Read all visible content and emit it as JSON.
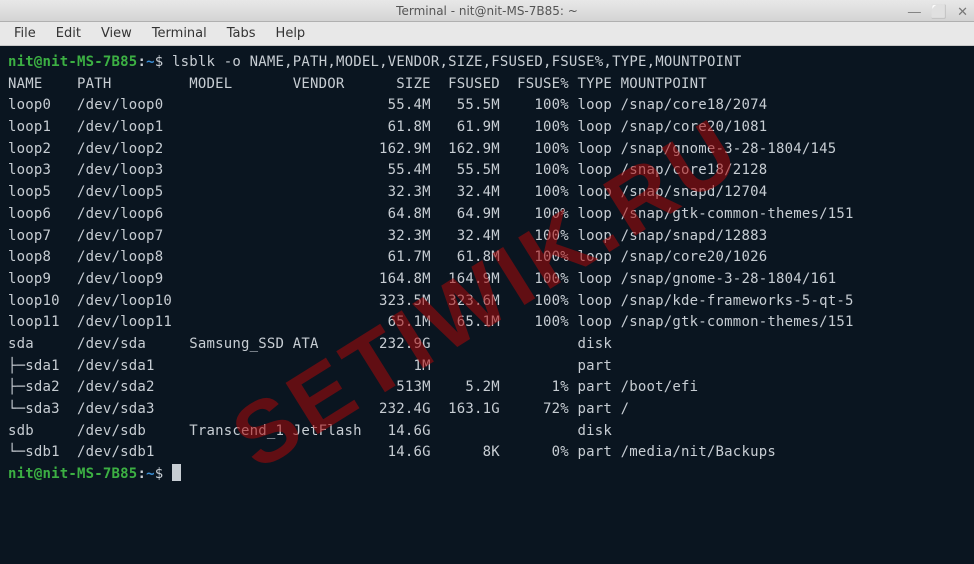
{
  "window": {
    "title": "Terminal - nit@nit-MS-7B85: ~",
    "controls": {
      "minimize": "—",
      "maximize": "⬜",
      "close": "✕"
    }
  },
  "menubar": [
    "File",
    "Edit",
    "View",
    "Terminal",
    "Tabs",
    "Help"
  ],
  "prompt": {
    "user_host": "nit@nit-MS-7B85",
    "sep": ":",
    "path": "~",
    "dollar": "$"
  },
  "command": "lsblk -o NAME,PATH,MODEL,VENDOR,SIZE,FSUSED,FSUSE%,TYPE,MOUNTPOINT",
  "header": [
    "NAME",
    "PATH",
    "MODEL",
    "VENDOR",
    "SIZE",
    "FSUSED",
    "FSUSE%",
    "TYPE",
    "MOUNTPOINT"
  ],
  "rows": [
    {
      "tree": "",
      "name": "loop0",
      "path": "/dev/loop0",
      "model": "",
      "vendor": "",
      "size": "55.4M",
      "fsused": "55.5M",
      "fsuse": "100%",
      "type": "loop",
      "mount": "/snap/core18/2074"
    },
    {
      "tree": "",
      "name": "loop1",
      "path": "/dev/loop1",
      "model": "",
      "vendor": "",
      "size": "61.8M",
      "fsused": "61.9M",
      "fsuse": "100%",
      "type": "loop",
      "mount": "/snap/core20/1081"
    },
    {
      "tree": "",
      "name": "loop2",
      "path": "/dev/loop2",
      "model": "",
      "vendor": "",
      "size": "162.9M",
      "fsused": "162.9M",
      "fsuse": "100%",
      "type": "loop",
      "mount": "/snap/gnome-3-28-1804/145"
    },
    {
      "tree": "",
      "name": "loop3",
      "path": "/dev/loop3",
      "model": "",
      "vendor": "",
      "size": "55.4M",
      "fsused": "55.5M",
      "fsuse": "100%",
      "type": "loop",
      "mount": "/snap/core18/2128"
    },
    {
      "tree": "",
      "name": "loop5",
      "path": "/dev/loop5",
      "model": "",
      "vendor": "",
      "size": "32.3M",
      "fsused": "32.4M",
      "fsuse": "100%",
      "type": "loop",
      "mount": "/snap/snapd/12704"
    },
    {
      "tree": "",
      "name": "loop6",
      "path": "/dev/loop6",
      "model": "",
      "vendor": "",
      "size": "64.8M",
      "fsused": "64.9M",
      "fsuse": "100%",
      "type": "loop",
      "mount": "/snap/gtk-common-themes/151"
    },
    {
      "tree": "",
      "name": "loop7",
      "path": "/dev/loop7",
      "model": "",
      "vendor": "",
      "size": "32.3M",
      "fsused": "32.4M",
      "fsuse": "100%",
      "type": "loop",
      "mount": "/snap/snapd/12883"
    },
    {
      "tree": "",
      "name": "loop8",
      "path": "/dev/loop8",
      "model": "",
      "vendor": "",
      "size": "61.7M",
      "fsused": "61.8M",
      "fsuse": "100%",
      "type": "loop",
      "mount": "/snap/core20/1026"
    },
    {
      "tree": "",
      "name": "loop9",
      "path": "/dev/loop9",
      "model": "",
      "vendor": "",
      "size": "164.8M",
      "fsused": "164.9M",
      "fsuse": "100%",
      "type": "loop",
      "mount": "/snap/gnome-3-28-1804/161"
    },
    {
      "tree": "",
      "name": "loop10",
      "path": "/dev/loop10",
      "model": "",
      "vendor": "",
      "size": "323.5M",
      "fsused": "323.6M",
      "fsuse": "100%",
      "type": "loop",
      "mount": "/snap/kde-frameworks-5-qt-5"
    },
    {
      "tree": "",
      "name": "loop11",
      "path": "/dev/loop11",
      "model": "",
      "vendor": "",
      "size": "65.1M",
      "fsused": "65.1M",
      "fsuse": "100%",
      "type": "loop",
      "mount": "/snap/gtk-common-themes/151"
    },
    {
      "tree": "",
      "name": "sda",
      "path": "/dev/sda",
      "model": "Samsung_SSD",
      "vendor": "ATA",
      "size": "232.9G",
      "fsused": "",
      "fsuse": "",
      "type": "disk",
      "mount": ""
    },
    {
      "tree": "├─",
      "name": "sda1",
      "path": "/dev/sda1",
      "model": "",
      "vendor": "",
      "size": "1M",
      "fsused": "",
      "fsuse": "",
      "type": "part",
      "mount": ""
    },
    {
      "tree": "├─",
      "name": "sda2",
      "path": "/dev/sda2",
      "model": "",
      "vendor": "",
      "size": "513M",
      "fsused": "5.2M",
      "fsuse": "1%",
      "type": "part",
      "mount": "/boot/efi"
    },
    {
      "tree": "└─",
      "name": "sda3",
      "path": "/dev/sda3",
      "model": "",
      "vendor": "",
      "size": "232.4G",
      "fsused": "163.1G",
      "fsuse": "72%",
      "type": "part",
      "mount": "/"
    },
    {
      "tree": "",
      "name": "sdb",
      "path": "/dev/sdb",
      "model": "Transcend_1",
      "vendor": "JetFlash",
      "size": "14.6G",
      "fsused": "",
      "fsuse": "",
      "type": "disk",
      "mount": ""
    },
    {
      "tree": "└─",
      "name": "sdb1",
      "path": "/dev/sdb1",
      "model": "",
      "vendor": "",
      "size": "14.6G",
      "fsused": "8K",
      "fsuse": "0%",
      "type": "part",
      "mount": "/media/nit/Backups"
    }
  ],
  "watermark": "SETIWIK.RU"
}
